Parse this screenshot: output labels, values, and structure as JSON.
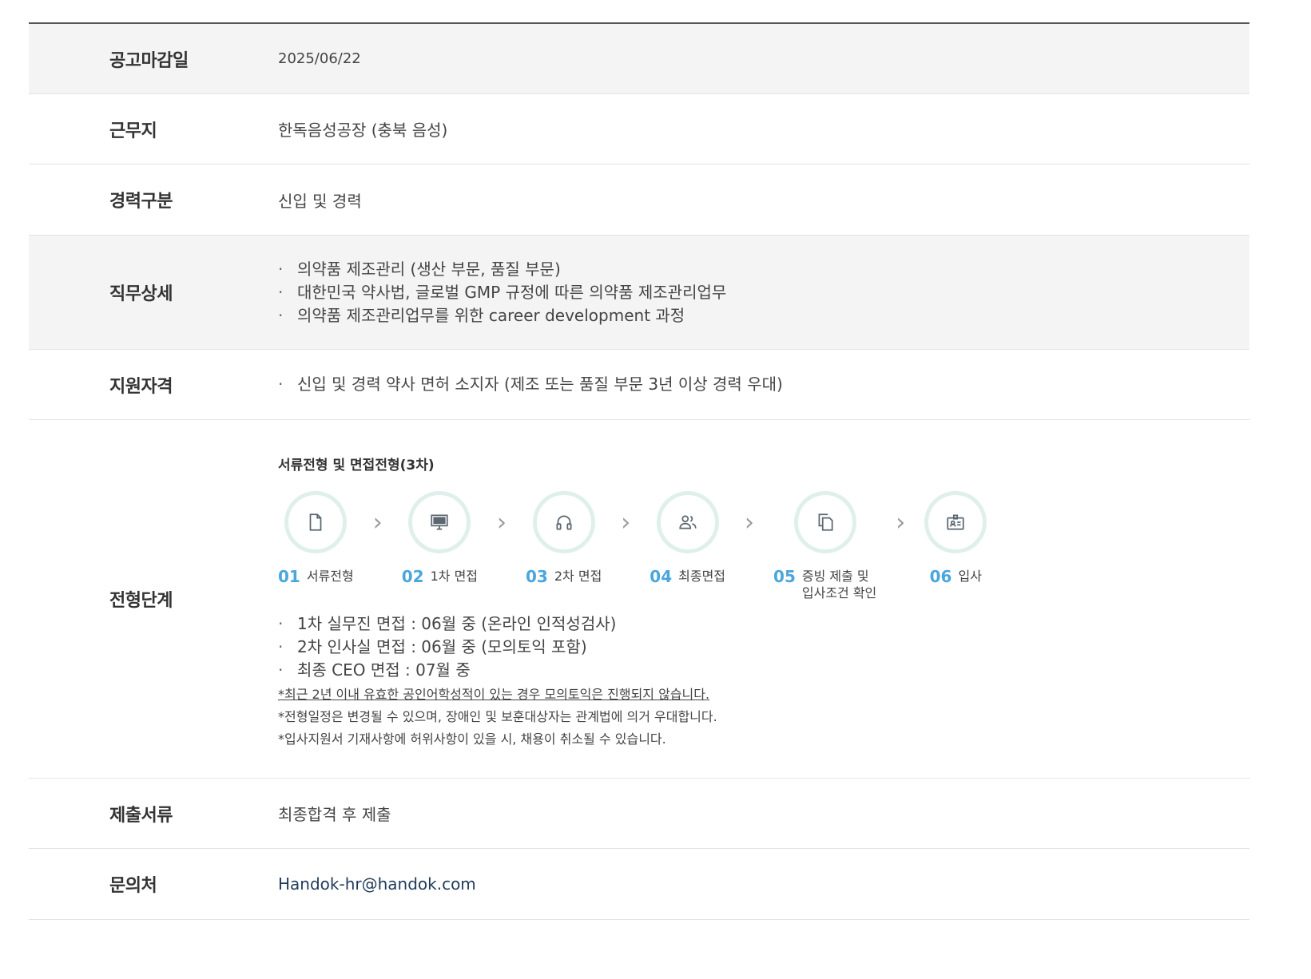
{
  "rows": {
    "deadline": {
      "label": "공고마감일",
      "value": "2025/06/22"
    },
    "location": {
      "label": "근무지",
      "value": "한독음성공장 (충북 음성)"
    },
    "career": {
      "label": "경력구분",
      "value": "신입 및 경력"
    },
    "duties": {
      "label": "직무상세",
      "items": [
        "의약품 제조관리 (생산 부문, 품질 부문)",
        "대한민국 약사법, 글로벌 GMP 규정에 따른 의약품 제조관리업무",
        "의약품 제조관리업무를 위한 career development 과정"
      ]
    },
    "qualification": {
      "label": "지원자격",
      "items": [
        "신입 및 경력 약사 면허 소지자 (제조 또는 품질 부문 3년 이상 경력 우대)"
      ]
    },
    "process": {
      "label": "전형단계",
      "title": "서류전형 및 면접전형(3차)",
      "steps": [
        {
          "num": "01",
          "text": "서류전형",
          "icon": "document-icon"
        },
        {
          "num": "02",
          "text": "1차 면접",
          "icon": "monitor-icon"
        },
        {
          "num": "03",
          "text": "2차 면접",
          "icon": "headset-icon"
        },
        {
          "num": "04",
          "text": "최종면접",
          "icon": "users-icon"
        },
        {
          "num": "05",
          "text": "증빙 제출 및",
          "text2": "입사조건 확인",
          "icon": "copy-icon"
        },
        {
          "num": "06",
          "text": "입사",
          "icon": "id-card-icon"
        }
      ],
      "schedule": [
        "1차 실무진 면접 : 06월 중 (온라인 인적성검사)",
        "2차 인사실 면접 : 06월 중 (모의토익 포함)",
        "최종 CEO 면접 : 07월 중"
      ],
      "notes": [
        "*최근 2년 이내 유효한 공인어학성적이 있는 경우 모의토익은 진행되지 않습니다.",
        "*전형일정은 변경될 수 있으며, 장애인 및 보훈대상자는 관계법에 의거 우대합니다.",
        "*입사지원서 기재사항에 허위사항이 있을 시, 채용이 취소될 수 있습니다."
      ]
    },
    "documents": {
      "label": "제출서류",
      "value": "최종합격 후 제출"
    },
    "contact": {
      "label": "문의처",
      "value": "Handok-hr@handok.com"
    }
  },
  "colors": {
    "accent": "#4aa6dd",
    "circle_border": "#dff0ec",
    "icon": "#5a6670",
    "row_shade": "#f4f4f4"
  },
  "bullet_symbol": "·"
}
